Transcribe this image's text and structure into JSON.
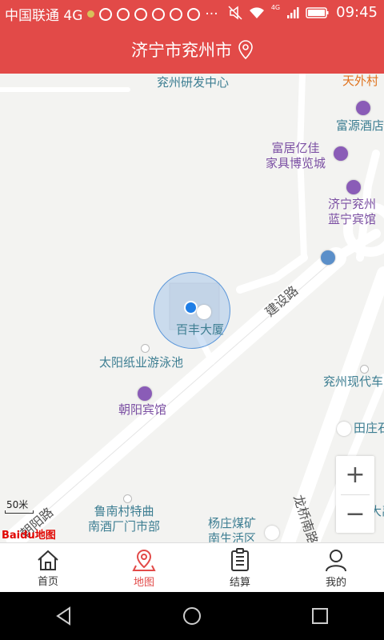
{
  "status_bar": {
    "carrier": "中国联通 4G",
    "time": "09:45",
    "network_badge": "4G"
  },
  "header": {
    "title": "济宁市兖州市",
    "icon": "location-pin-icon"
  },
  "map": {
    "pois": [
      {
        "label": "兖州研发中心",
        "color": "teal"
      },
      {
        "label": "天外村",
        "color": "orange"
      },
      {
        "label": "富源酒店",
        "color": "teal"
      },
      {
        "label": "富居亿佳\n家具博览城",
        "color": "purple"
      },
      {
        "label": "济宁兖州\n蓝宁宾馆",
        "color": "purple"
      },
      {
        "label": "百丰大厦",
        "color": "teal"
      },
      {
        "label": "太阳纸业游泳池",
        "color": "teal"
      },
      {
        "label": "朝阳宾馆",
        "color": "purple"
      },
      {
        "label": "兖州现代车",
        "color": "teal"
      },
      {
        "label": "田庄石",
        "color": "teal"
      },
      {
        "label": "鲁南村特曲\n南酒厂门市部",
        "color": "teal"
      },
      {
        "label": "杨庄煤矿\n南生活区",
        "color": "teal"
      },
      {
        "label": "大禹",
        "color": "teal"
      }
    ],
    "roads": {
      "diagonal_road": "建设路",
      "road_bottom_left": "朝阳路",
      "road_right": "龙桥南路"
    },
    "scale_label": "50米",
    "logo_text": "Baidu地图",
    "zoom_in": "+",
    "zoom_out": "−"
  },
  "tabs": [
    {
      "label": "首页",
      "icon": "home-icon",
      "active": false
    },
    {
      "label": "地图",
      "icon": "map-pin-icon",
      "active": true
    },
    {
      "label": "结算",
      "icon": "receipt-icon",
      "active": false
    },
    {
      "label": "我的",
      "icon": "user-icon",
      "active": false
    }
  ],
  "colors": {
    "brand": "#e24a48",
    "map_bg": "#f3f3f1",
    "poi_teal": "#3d7e92",
    "poi_purple": "#7b4fa3",
    "location_blue": "#1f7ee6"
  }
}
